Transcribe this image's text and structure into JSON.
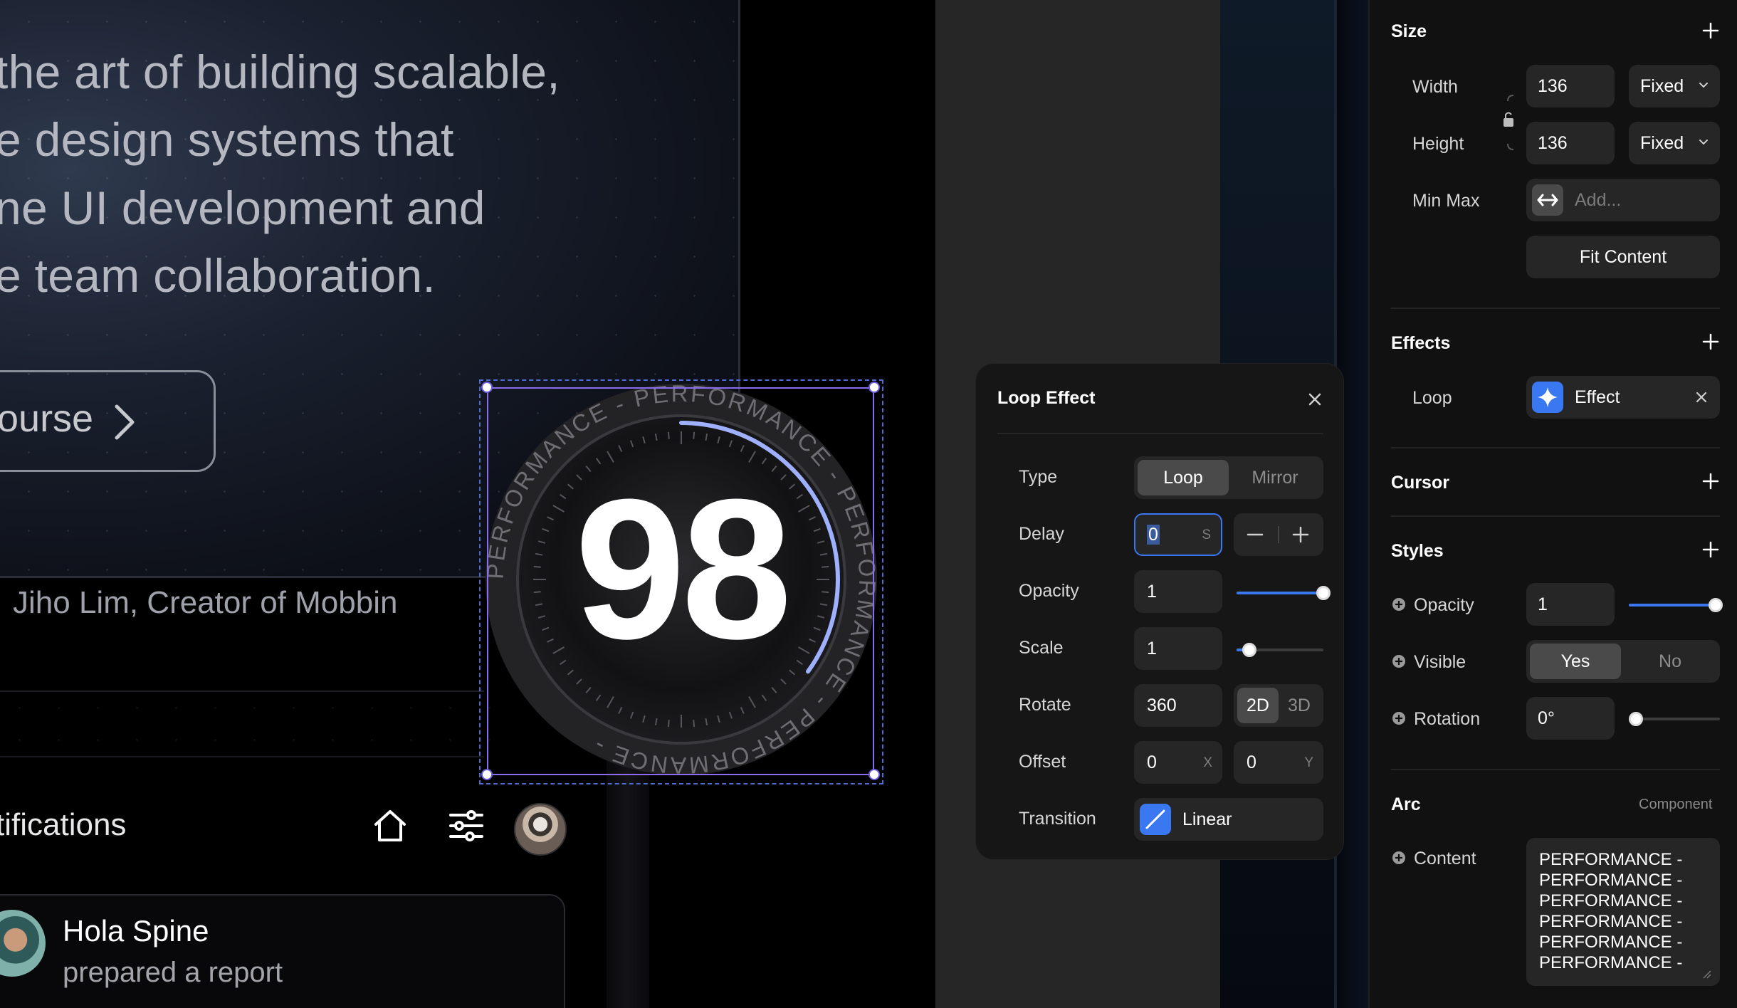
{
  "hero": {
    "quote_lines": [
      "the art of building scalable,",
      "e design systems that",
      "ne UI development and",
      "e team collaboration."
    ],
    "course_button": "ourse",
    "attribution": "Jiho Lim, Creator of Mobbin"
  },
  "notifications": {
    "title": "tifications",
    "item": {
      "name": "Hola Spine",
      "text": "prepared a report"
    }
  },
  "gauge": {
    "value": "98",
    "arc_text": "PERFORMANCE - PERFORMANCE - PERFORMANCE - PERFORMANCE - ",
    "progress": 0.35
  },
  "loop_effect": {
    "title": "Loop Effect",
    "type": {
      "label": "Type",
      "options": [
        "Loop",
        "Mirror"
      ],
      "selected": "Loop"
    },
    "delay": {
      "label": "Delay",
      "value": "0",
      "unit": "S"
    },
    "opacity": {
      "label": "Opacity",
      "value": "1",
      "level": 1.0
    },
    "scale": {
      "label": "Scale",
      "value": "1",
      "level": 0.15
    },
    "rotate": {
      "label": "Rotate",
      "value": "360",
      "options": [
        "2D",
        "3D"
      ],
      "selected": "2D"
    },
    "offset": {
      "label": "Offset",
      "x": "0",
      "x_unit": "X",
      "y": "0",
      "y_unit": "Y"
    },
    "transition": {
      "label": "Transition",
      "value": "Linear"
    }
  },
  "sidebar": {
    "size": {
      "title": "Size",
      "width_label": "Width",
      "width_value": "136",
      "width_mode": "Fixed",
      "height_label": "Height",
      "height_value": "136",
      "height_mode": "Fixed",
      "minmax_label": "Min Max",
      "minmax_placeholder": "Add...",
      "fit_button": "Fit Content"
    },
    "effects": {
      "title": "Effects",
      "loop_label": "Loop",
      "effect_value": "Effect"
    },
    "cursor": {
      "title": "Cursor"
    },
    "styles": {
      "title": "Styles",
      "opacity_label": "Opacity",
      "opacity_value": "1",
      "opacity_level": 1.0,
      "visible_label": "Visible",
      "visible_options": [
        "Yes",
        "No"
      ],
      "visible_selected": "Yes",
      "rotation_label": "Rotation",
      "rotation_value": "0°",
      "rotation_level": 0.0
    },
    "arc": {
      "title": "Arc",
      "tag": "Component",
      "content_label": "Content",
      "content_lines": [
        "PERFORMANCE -",
        "PERFORMANCE -",
        "PERFORMANCE -",
        "PERFORMANCE -",
        "PERFORMANCE -",
        "PERFORMANCE -"
      ]
    }
  },
  "colors": {
    "accent": "#3a78f2",
    "selection": "#8a6cf0",
    "panel": "#161616",
    "field": "#262626"
  }
}
